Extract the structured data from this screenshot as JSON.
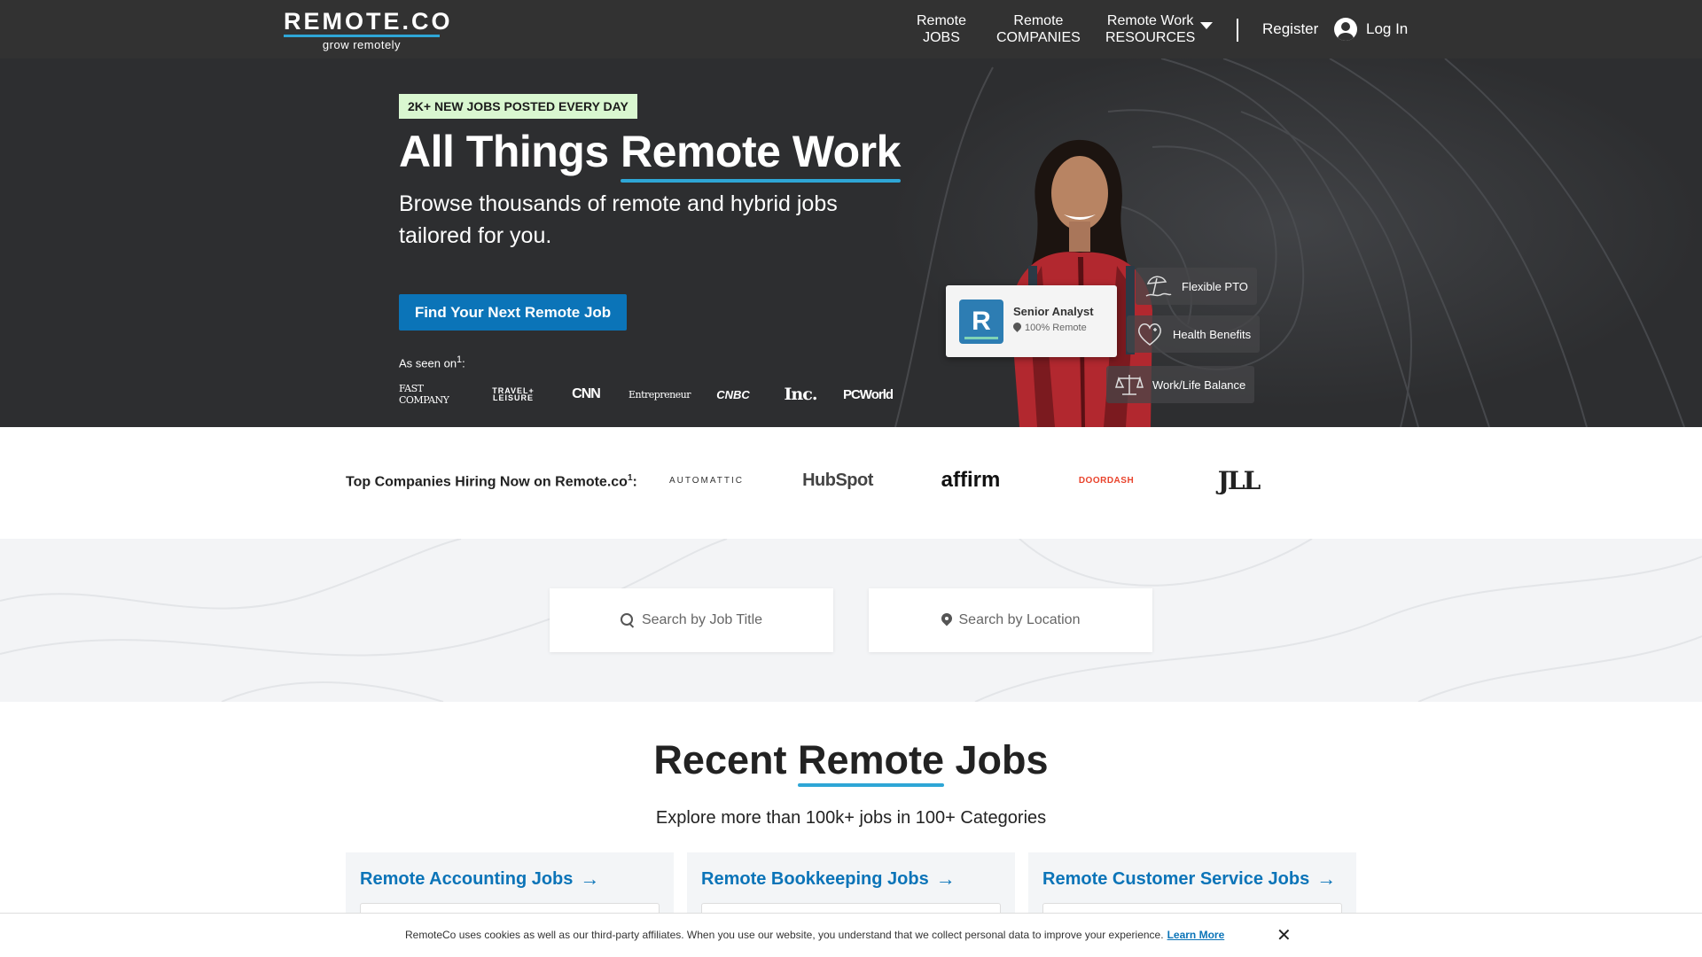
{
  "header": {
    "logo": "REMOTE.CO",
    "tagline": "grow remotely",
    "nav": [
      {
        "line1": "Remote",
        "line2": "JOBS"
      },
      {
        "line1": "Remote",
        "line2": "COMPANIES"
      },
      {
        "line1": "Remote Work",
        "line2": "RESOURCES"
      }
    ],
    "register": "Register",
    "login": "Log In"
  },
  "hero": {
    "badge": "2K+ NEW JOBS POSTED EVERY DAY",
    "title_part1": "All Things ",
    "title_highlight": "Remote Work",
    "subtitle": "Browse thousands of remote and hybrid jobs tailored for you.",
    "cta": "Find Your Next Remote Job",
    "as_seen_on": "As seen on",
    "as_seen_on_sup": "1",
    "press": [
      "FAST COMPANY",
      "TRAVEL+ LEISURE",
      "CNN",
      "Entrepreneur",
      "CNBC",
      "Inc.",
      "PCWorld"
    ],
    "card": {
      "logo_letter": "R",
      "title": "Senior Analyst",
      "subtitle": "100% Remote"
    },
    "perks": [
      "Flexible PTO",
      "Health Benefits",
      "Work/Life Balance"
    ]
  },
  "companies": {
    "label": "Top Companies Hiring Now on Remote.co",
    "label_sup": "1",
    "logos": [
      "AUTOMATTIC",
      "HubSpot",
      "affirm",
      "DOORDASH",
      "JLL"
    ]
  },
  "search": {
    "job_title_placeholder": "Search by Job Title",
    "location_placeholder": "Search by Location"
  },
  "recent": {
    "title_part1": "Recent ",
    "title_highlight": "Remote",
    "title_part2": " Jobs",
    "subtitle": "Explore more than 100k+ jobs in 100+ Categories",
    "categories": [
      "Remote Accounting Jobs",
      "Remote Bookkeeping Jobs",
      "Remote Customer Service Jobs"
    ]
  },
  "cookie": {
    "text": "RemoteCo uses cookies as well as our third-party affiliates. When you use our website, you understand that we collect personal data to improve your experience.",
    "link": "Learn More",
    "close": "✕"
  },
  "colors": {
    "header_bg": "#323232",
    "hero_bg": "#2d2e30",
    "accent": "#2ea6d6",
    "cta_bg": "#0b74b8",
    "badge_bg": "#d9f7d0",
    "link": "#0b74b8"
  }
}
